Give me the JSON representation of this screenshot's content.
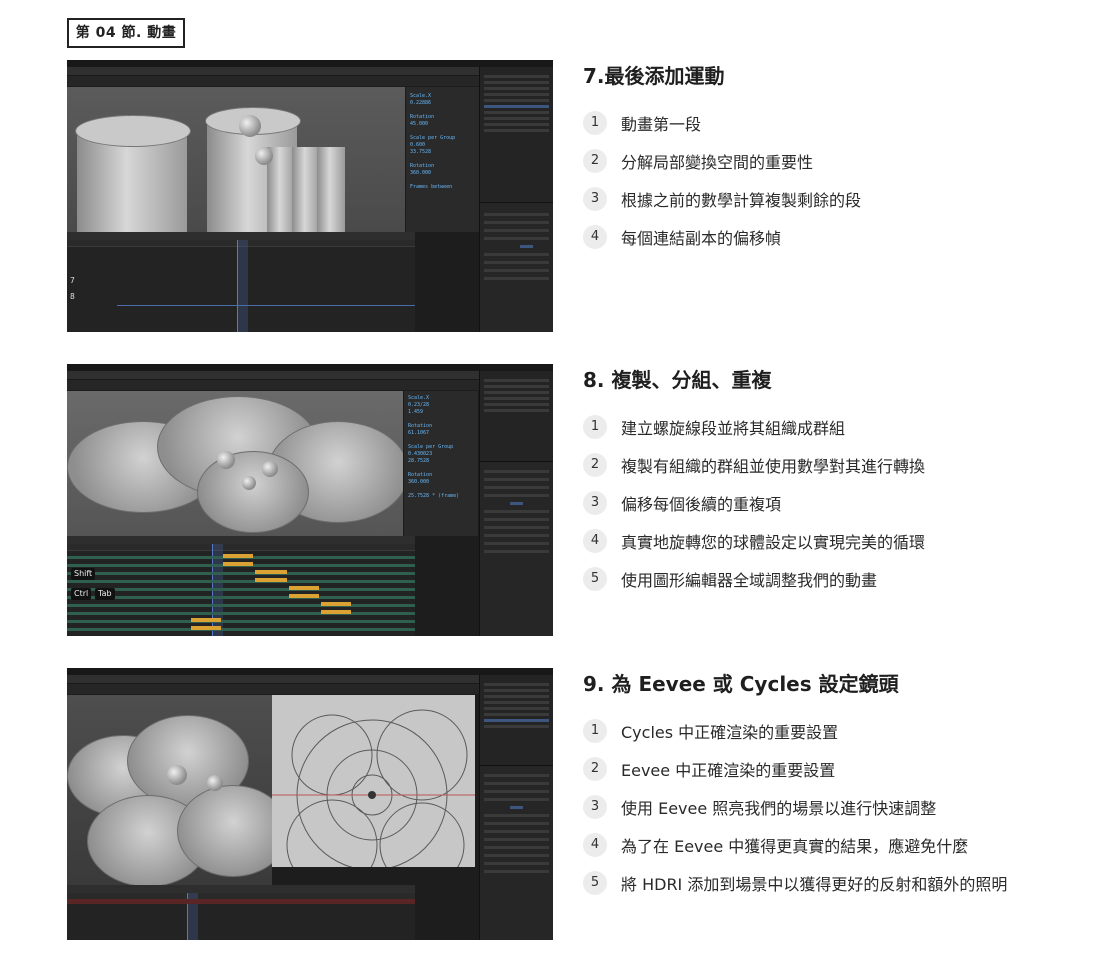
{
  "chapter": {
    "label": "第 04 節. 動畫"
  },
  "sections": [
    {
      "title": "7.最後添加運動",
      "steps": [
        {
          "num": "1",
          "text": "動畫第一段"
        },
        {
          "num": "2",
          "text": "分解局部變換空間的重要性"
        },
        {
          "num": "3",
          "text": "根據之前的數學計算複製剩餘的段"
        },
        {
          "num": "4",
          "text": "每個連結副本的偏移幀"
        }
      ]
    },
    {
      "title": "8. 複製、分組、重複",
      "steps": [
        {
          "num": "1",
          "text": "建立螺旋線段並將其組織成群組"
        },
        {
          "num": "2",
          "text": "複製有組織的群組並使用數學對其進行轉換"
        },
        {
          "num": "3",
          "text": "偏移每個後續的重複項"
        },
        {
          "num": "4",
          "text": "真實地旋轉您的球體設定以實現完美的循環"
        },
        {
          "num": "5",
          "text": "使用圖形編輯器全域調整我們的動畫"
        }
      ]
    },
    {
      "title": "9. 為 Eevee 或 Cycles 設定鏡頭",
      "steps": [
        {
          "num": "1",
          "text": "Cycles 中正確渲染的重要設置"
        },
        {
          "num": "2",
          "text": "Eevee 中正確渲染的重要設置"
        },
        {
          "num": "3",
          "text": "使用 Eevee 照亮我們的場景以進行快速調整"
        },
        {
          "num": "4",
          "text": "為了在 Eevee 中獲得更真實的結果，應避免什麼"
        },
        {
          "num": "5",
          "text": "將 HDRI 添加到場景中以獲得更好的反射和額外的照明"
        }
      ]
    }
  ],
  "screenshots": {
    "shot1": {
      "frame_labels": [
        "7",
        "8"
      ]
    },
    "shot2": {
      "key_hints": [
        "Shift",
        "Ctrl",
        "Tab"
      ]
    }
  },
  "colors": {
    "blender_bg": "#1d1d1d",
    "keyframe": "#d9a233",
    "selection": "#3d5680",
    "step_badge": "#ececec"
  }
}
